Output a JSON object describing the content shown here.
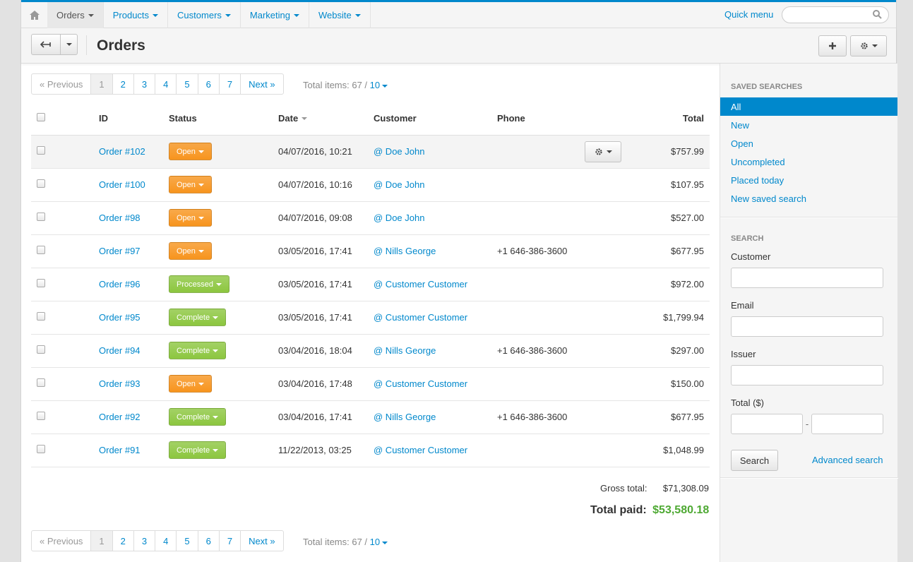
{
  "nav": {
    "home_icon": "home-icon",
    "items": [
      {
        "label": "Orders",
        "active": true
      },
      {
        "label": "Products",
        "active": false
      },
      {
        "label": "Customers",
        "active": false
      },
      {
        "label": "Marketing",
        "active": false
      },
      {
        "label": "Website",
        "active": false
      }
    ],
    "quick_menu": "Quick menu",
    "search_placeholder": ""
  },
  "toolbar": {
    "title": "Orders"
  },
  "pager": {
    "prev": "« Previous",
    "pages": [
      "1",
      "2",
      "3",
      "4",
      "5",
      "6",
      "7"
    ],
    "current": "1",
    "next": "Next »",
    "total_text": "Total items: 67 / ",
    "per_page": "10"
  },
  "table": {
    "headers": {
      "id": "ID",
      "status": "Status",
      "date": "Date",
      "customer": "Customer",
      "phone": "Phone",
      "total": "Total"
    },
    "rows": [
      {
        "id": "Order #102",
        "status": "Open",
        "date": "04/07/2016, 10:21",
        "customer": "@ Doe John",
        "phone": "",
        "total": "$757.99"
      },
      {
        "id": "Order #100",
        "status": "Open",
        "date": "04/07/2016, 10:16",
        "customer": "@ Doe John",
        "phone": "",
        "total": "$107.95"
      },
      {
        "id": "Order #98",
        "status": "Open",
        "date": "04/07/2016, 09:08",
        "customer": "@ Doe John",
        "phone": "",
        "total": "$527.00"
      },
      {
        "id": "Order #97",
        "status": "Open",
        "date": "03/05/2016, 17:41",
        "customer": "@ Nills George",
        "phone": "+1 646-386-3600",
        "total": "$677.95"
      },
      {
        "id": "Order #96",
        "status": "Processed",
        "date": "03/05/2016, 17:41",
        "customer": "@ Customer Customer",
        "phone": "",
        "total": "$972.00"
      },
      {
        "id": "Order #95",
        "status": "Complete",
        "date": "03/05/2016, 17:41",
        "customer": "@ Customer Customer",
        "phone": "",
        "total": "$1,799.94"
      },
      {
        "id": "Order #94",
        "status": "Complete",
        "date": "03/04/2016, 18:04",
        "customer": "@ Nills George",
        "phone": "+1 646-386-3600",
        "total": "$297.00"
      },
      {
        "id": "Order #93",
        "status": "Open",
        "date": "03/04/2016, 17:48",
        "customer": "@ Customer Customer",
        "phone": "",
        "total": "$150.00"
      },
      {
        "id": "Order #92",
        "status": "Complete",
        "date": "03/04/2016, 17:41",
        "customer": "@ Nills George",
        "phone": "+1 646-386-3600",
        "total": "$677.95"
      },
      {
        "id": "Order #91",
        "status": "Complete",
        "date": "11/22/2013, 03:25",
        "customer": "@ Customer Customer",
        "phone": "",
        "total": "$1,048.99"
      }
    ]
  },
  "status_colors": {
    "Open": "#f7941d",
    "Processed": "#8cc63f",
    "Complete": "#8cc63f"
  },
  "summary": {
    "gross_label": "Gross total:",
    "gross_value": "$71,308.09",
    "paid_label": "Total paid:",
    "paid_value": "$53,580.18"
  },
  "sidebar": {
    "saved_title": "SAVED SEARCHES",
    "saved": [
      "All",
      "New",
      "Open",
      "Uncompleted",
      "Placed today",
      "New saved search"
    ],
    "search_title": "SEARCH",
    "customer_label": "Customer",
    "email_label": "Email",
    "issuer_label": "Issuer",
    "total_label": "Total ($)",
    "range_sep": "-",
    "search_button": "Search",
    "advanced_link": "Advanced search"
  }
}
